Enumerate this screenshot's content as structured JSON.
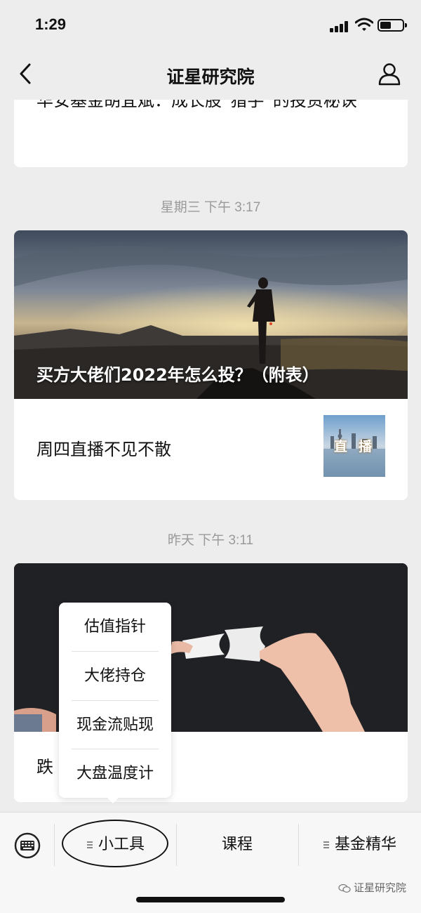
{
  "status_bar": {
    "time": "1:29",
    "battery_level": 0.5
  },
  "nav": {
    "title": "证星研究院"
  },
  "articles": [
    {
      "title": "华安基金胡宜斌：成长股“猎手”的投资秘诀"
    },
    {
      "timestamp": "星期三 下午 3:17",
      "main_title": "买方大佬们2022年怎么投？（附表）",
      "sub_title": "周四直播不见不散",
      "thumb_text": "直播"
    },
    {
      "timestamp": "昨天 下午 3:11",
      "sub_title": "跌"
    }
  ],
  "popup_menu": {
    "items": [
      "估值指针",
      "大佬持仓",
      "现金流贴现",
      "大盘温度计"
    ]
  },
  "bottom_menu": {
    "tabs": [
      "小工具",
      "课程",
      "基金精华"
    ]
  },
  "watermark": "证星研究院"
}
